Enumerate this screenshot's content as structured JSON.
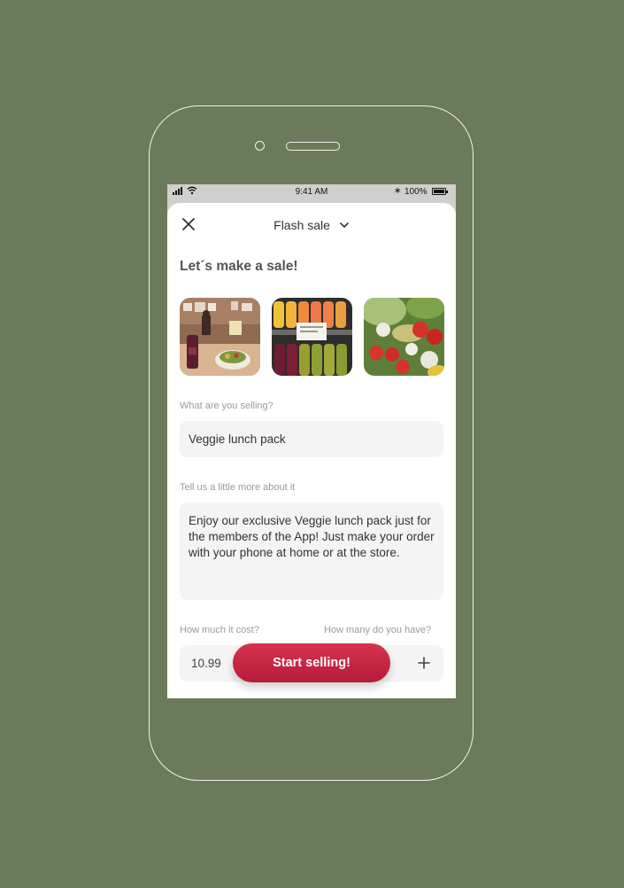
{
  "status_bar": {
    "time": "9:41 AM",
    "battery": "100%",
    "battery_level": 1.0
  },
  "header": {
    "title": "Flash sale"
  },
  "heading": "Let´s make a sale!",
  "photos": [
    {
      "icon": "cafe-photo"
    },
    {
      "icon": "juice-bottles-photo"
    },
    {
      "icon": "salad-photo"
    }
  ],
  "form": {
    "item_label": "What are you selling?",
    "item_value": "Veggie lunch pack",
    "description_label": "Tell us a little more about it",
    "description_value": "Enjoy our exclusive Veggie lunch pack just for the members of the App! Just make your order with your phone at home or at the store.",
    "price_label": "How much it cost?",
    "price_value": "10.99",
    "quantity_label": "How many do you have?"
  },
  "cta_label": "Start selling!",
  "colors": {
    "background": "#6a7a5a",
    "accent": "#c8243f",
    "field_background": "#f4f4f4"
  }
}
